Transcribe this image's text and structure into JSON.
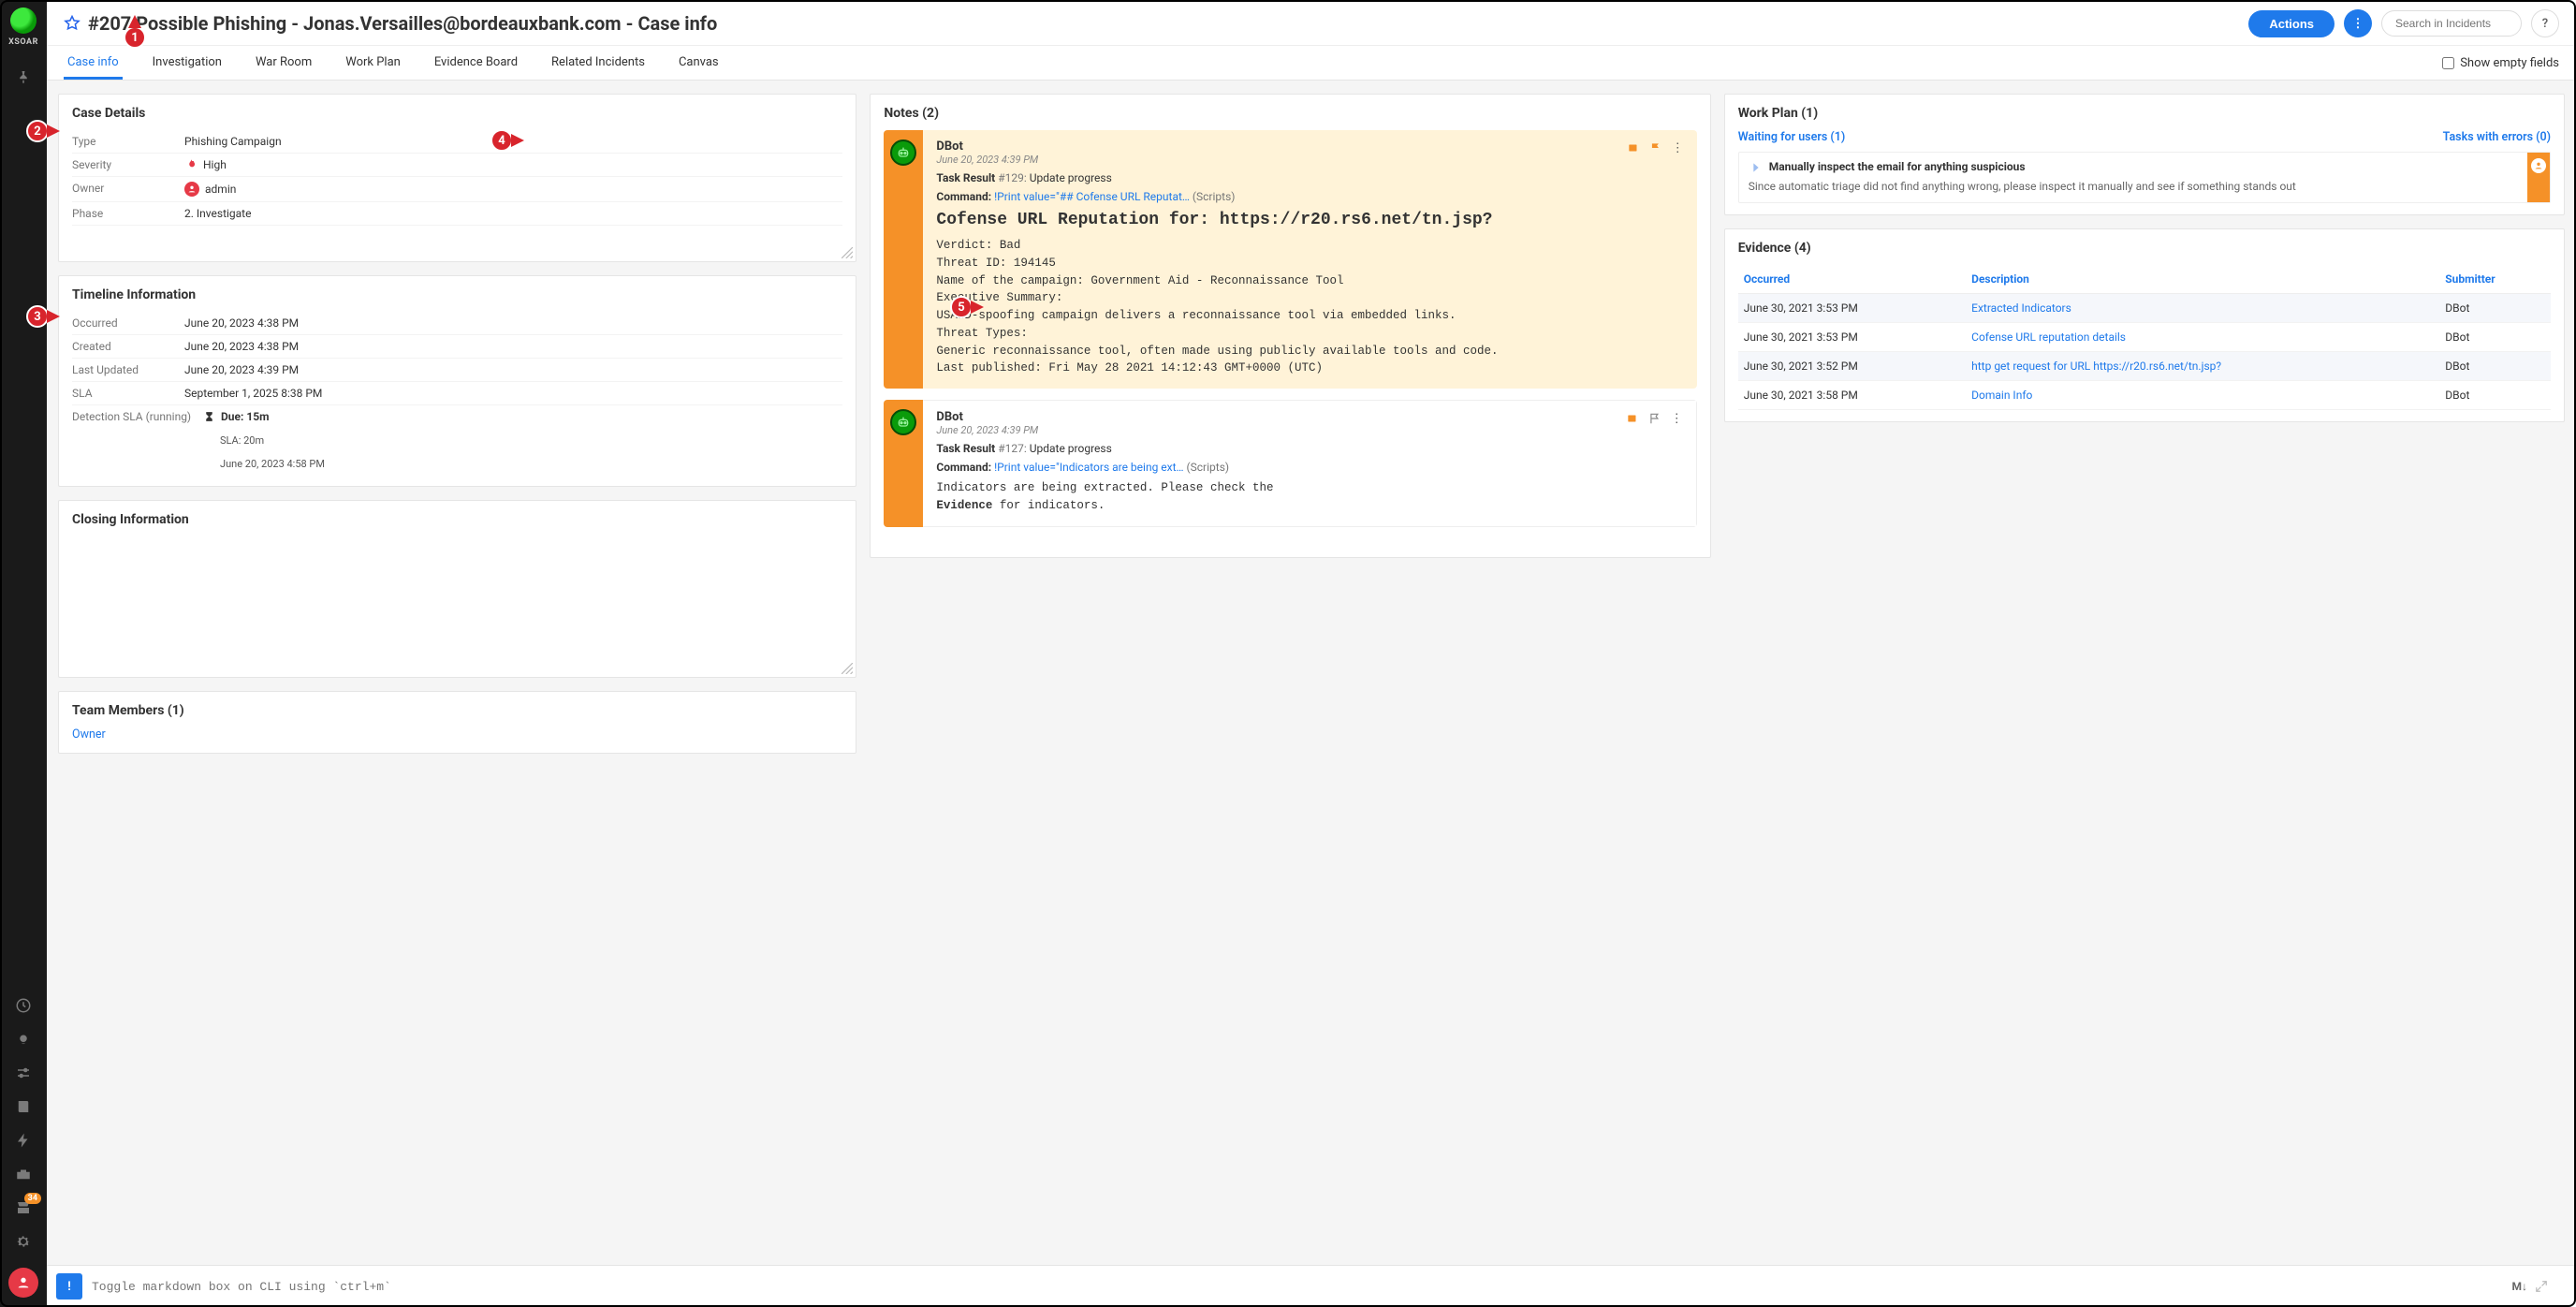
{
  "brand": "XSOAR",
  "header": {
    "title": "#207 Possible Phishing - Jonas.Versailles@bordeauxbank.com - Case info",
    "actions_label": "Actions",
    "search_placeholder": "Search in Incidents",
    "help_label": "?"
  },
  "tabs": {
    "items": [
      "Case info",
      "Investigation",
      "War Room",
      "Work Plan",
      "Evidence Board",
      "Related Incidents",
      "Canvas"
    ],
    "active": 0,
    "show_empty_label": "Show empty fields"
  },
  "case_details": {
    "title": "Case Details",
    "rows": {
      "type_label": "Type",
      "type_value": "Phishing Campaign",
      "severity_label": "Severity",
      "severity_value": "High",
      "owner_label": "Owner",
      "owner_value": "admin",
      "phase_label": "Phase",
      "phase_value": "2. Investigate"
    }
  },
  "timeline": {
    "title": "Timeline Information",
    "rows": {
      "occurred_label": "Occurred",
      "occurred_value": "June 20, 2023 4:38 PM",
      "created_label": "Created",
      "created_value": "June 20, 2023 4:38 PM",
      "updated_label": "Last Updated",
      "updated_value": "June 20, 2023 4:39 PM",
      "sla_label": "SLA",
      "sla_value": "September 1, 2025 8:38 PM",
      "detection_label": "Detection SLA (running)",
      "detection_due": "Due: 15m",
      "detection_sla20": "SLA: 20m",
      "detection_date": "June 20, 2023 4:58 PM"
    }
  },
  "closing": {
    "title": "Closing Information"
  },
  "team": {
    "title": "Team Members (1)",
    "owner_label": "Owner"
  },
  "notes": {
    "title": "Notes (2)",
    "n1": {
      "author": "DBot",
      "date": "June 20, 2023 4:39 PM",
      "task_label": "Task Result",
      "task_id": "#129:",
      "task_name": "Update progress",
      "command_label": "Command:",
      "command_link": "!Print value=\"## Cofense URL Reputat…",
      "command_suffix": "(Scripts)",
      "big_title": "Cofense URL Reputation for: https://r20.rs6.net/tn.jsp?",
      "mono_body": "Verdict: Bad\nThreat ID: 194145\nName of the campaign: Government Aid - Reconnaissance Tool\nExecutive Summary:\nUSAID-spoofing campaign delivers a reconnaissance tool via embedded links.\nThreat Types:\nGeneric reconnaissance tool, often made using publicly available tools and code.\nLast published: Fri May 28 2021 14:12:43 GMT+0000 (UTC)"
    },
    "n2": {
      "author": "DBot",
      "date": "June 20, 2023 4:39 PM",
      "task_label": "Task Result",
      "task_id": "#127:",
      "task_name": "Update progress",
      "command_label": "Command:",
      "command_link": "!Print value=\"Indicators are being ext…",
      "command_suffix": "(Scripts)",
      "mono_line1": "Indicators are being extracted. Please check the",
      "mono_bold": "Evidence",
      "mono_line2": " for indicators."
    }
  },
  "workplan": {
    "title": "Work Plan (1)",
    "waiting_link": "Waiting for users (1)",
    "errors_link": "Tasks with errors (0)",
    "card_title": "Manually inspect the email for anything suspicious",
    "card_desc": "Since automatic triage did not find anything wrong, please inspect it manually and see if something stands out"
  },
  "evidence": {
    "title": "Evidence (4)",
    "headers": {
      "occurred": "Occurred",
      "description": "Description",
      "submitter": "Submitter"
    },
    "rows": [
      {
        "occurred": "June 30, 2021 3:53 PM",
        "desc": "Extracted Indicators",
        "submitter": "DBot"
      },
      {
        "occurred": "June 30, 2021 3:53 PM",
        "desc": "Cofense URL reputation details",
        "submitter": "DBot"
      },
      {
        "occurred": "June 30, 2021 3:52 PM",
        "desc": "http get request for URL https://r20.rs6.net/tn.jsp?",
        "submitter": "DBot"
      },
      {
        "occurred": "June 30, 2021 3:58 PM",
        "desc": "Domain Info",
        "submitter": "DBot"
      }
    ]
  },
  "cli": {
    "placeholder": "Toggle markdown box on CLI using `ctrl+m`",
    "md_label": "M↓"
  },
  "sidebar": {
    "badge": "34"
  },
  "callouts": {
    "c1": "1",
    "c2": "2",
    "c3": "3",
    "c4": "4",
    "c5": "5"
  }
}
